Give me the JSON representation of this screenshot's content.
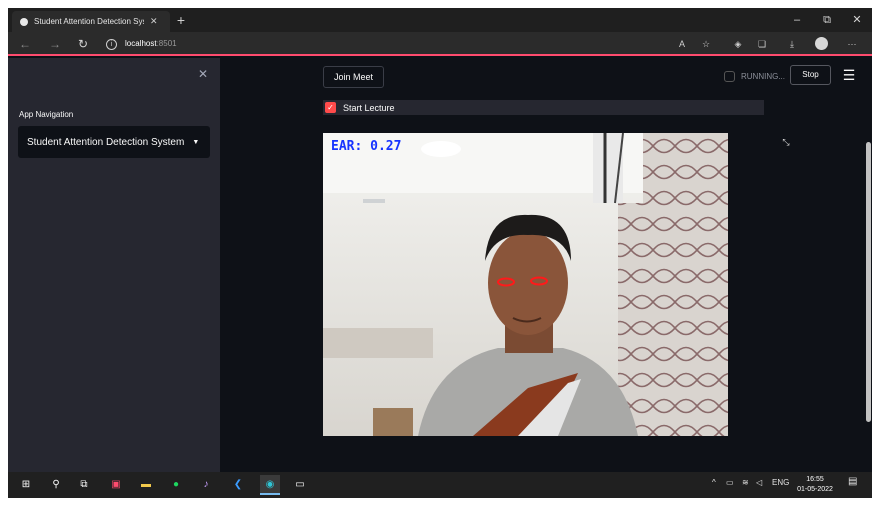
{
  "browser": {
    "tab_title": "Student Attention Detection Sys",
    "tab_close": "✕",
    "new_tab": "+",
    "url_host": "localhost",
    "url_port": ":8501",
    "window": {
      "minimize": "–",
      "restore": "⧉",
      "close": "✕"
    }
  },
  "sidebar": {
    "close": "✕",
    "nav_label": "App Navigation",
    "select_value": "Student Attention Detection System"
  },
  "main": {
    "join_button": "Join Meet",
    "status_text": "RUNNING...",
    "stop_button": "Stop",
    "menu_icon": "☰",
    "checkbox_checked": true,
    "checkbox_label": "Start Lecture",
    "ear_text": "EAR: 0.27"
  },
  "taskbar": {
    "time": "16:55",
    "date": "01-05-2022",
    "language": "ENG"
  },
  "colors": {
    "accent": "#ff4b4b",
    "sidebar_bg": "#262730",
    "main_bg": "#0e1117",
    "ear_text": "#1734ff",
    "eye_outline": "#ff1a1a"
  },
  "icons": {
    "back": "back-arrow-icon",
    "forward": "forward-arrow-icon",
    "refresh": "refresh-icon",
    "info": "info-icon",
    "fullscreen": "fullscreen-icon",
    "start": "windows-start-icon",
    "search": "search-icon"
  }
}
